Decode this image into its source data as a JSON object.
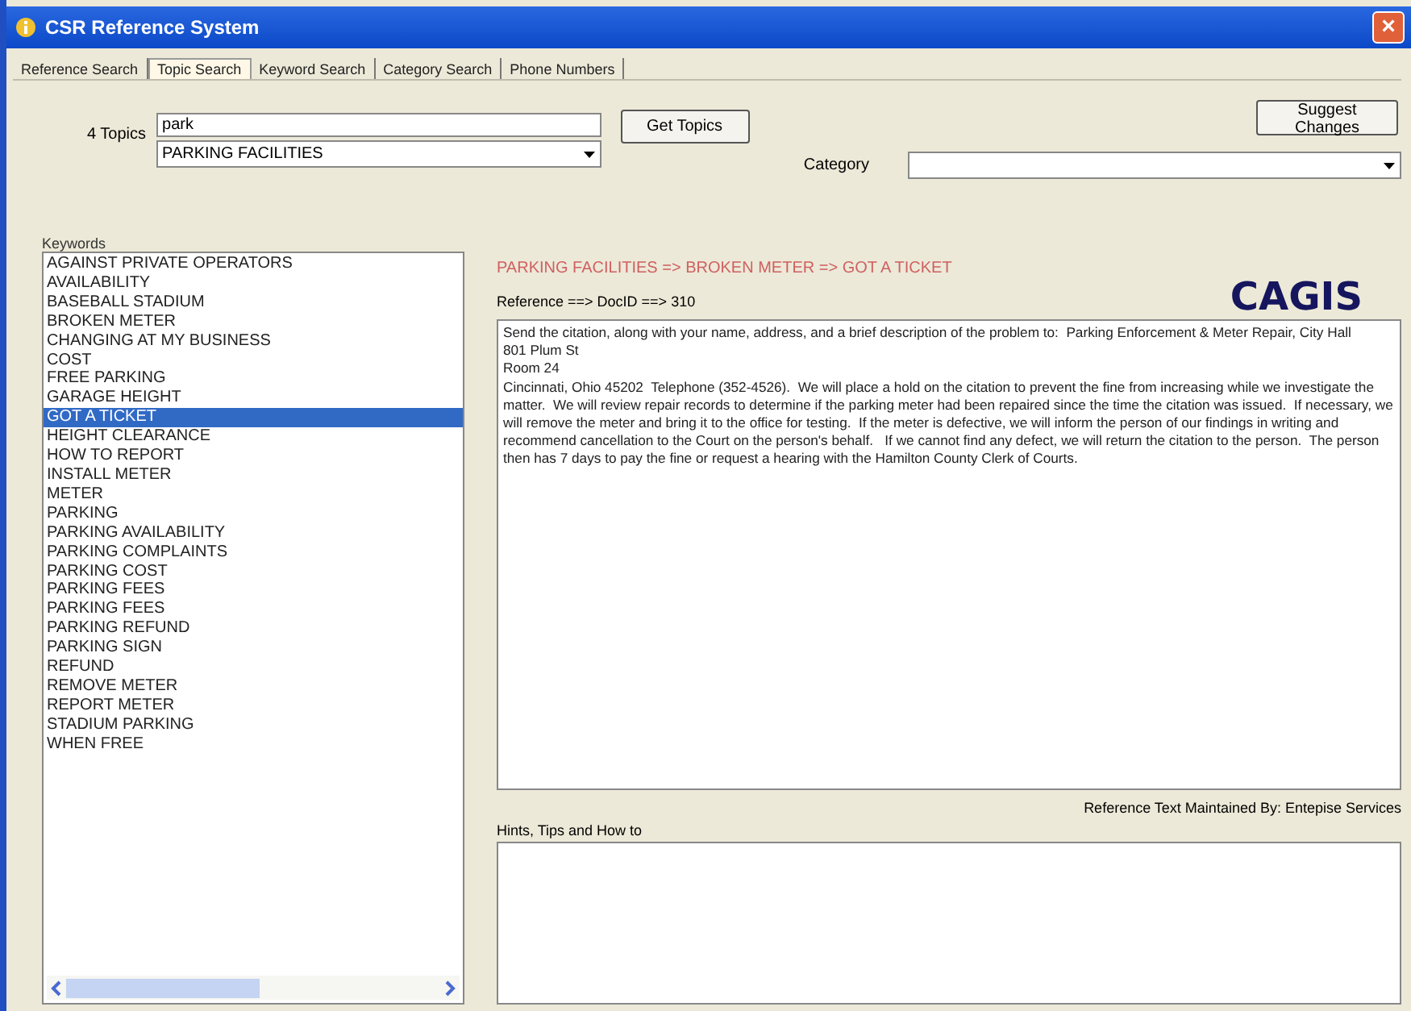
{
  "window": {
    "title": "CSR Reference System",
    "close": "×"
  },
  "tabs": [
    {
      "label": "Reference Search",
      "selected": false
    },
    {
      "label": "Topic Search",
      "selected": true
    },
    {
      "label": "Keyword Search",
      "selected": false
    },
    {
      "label": "Category Search",
      "selected": false
    },
    {
      "label": "Phone Numbers",
      "selected": false
    }
  ],
  "search": {
    "count_label": "4 Topics",
    "value": "park",
    "topic": "PARKING FACILITIES",
    "button": "Get Topics"
  },
  "suggest_button": "Suggest Changes",
  "category": {
    "label": "Category"
  },
  "keywords": {
    "label": "Keywords",
    "items": [
      {
        "label": "AGAINST PRIVATE OPERATORS",
        "selected": false
      },
      {
        "label": "AVAILABILITY",
        "selected": false
      },
      {
        "label": "BASEBALL STADIUM",
        "selected": false
      },
      {
        "label": "BROKEN METER",
        "selected": false
      },
      {
        "label": "CHANGING AT MY BUSINESS",
        "selected": false
      },
      {
        "label": "COST",
        "selected": false
      },
      {
        "label": "FREE PARKING",
        "selected": false
      },
      {
        "label": "GARAGE HEIGHT",
        "selected": false
      },
      {
        "label": "GOT A TICKET",
        "selected": true
      },
      {
        "label": "HEIGHT CLEARANCE",
        "selected": false
      },
      {
        "label": "HOW TO REPORT",
        "selected": false
      },
      {
        "label": "INSTALL METER",
        "selected": false
      },
      {
        "label": "METER",
        "selected": false
      },
      {
        "label": "PARKING",
        "selected": false
      },
      {
        "label": "PARKING AVAILABILITY",
        "selected": false
      },
      {
        "label": "PARKING COMPLAINTS",
        "selected": false
      },
      {
        "label": "PARKING COST",
        "selected": false
      },
      {
        "label": "PARKING FEES",
        "selected": false
      },
      {
        "label": "PARKING FEES",
        "selected": false
      },
      {
        "label": "PARKING REFUND",
        "selected": false
      },
      {
        "label": "PARKING SIGN",
        "selected": false
      },
      {
        "label": "REFUND",
        "selected": false
      },
      {
        "label": "REMOVE METER",
        "selected": false
      },
      {
        "label": "REPORT METER",
        "selected": false
      },
      {
        "label": "STADIUM PARKING",
        "selected": false
      },
      {
        "label": "WHEN FREE",
        "selected": false
      }
    ]
  },
  "detail": {
    "breadcrumb": "PARKING FACILITIES => BROKEN METER => GOT A TICKET",
    "reference": "Reference ==> DocID ==>  310",
    "logo": "CAGIS",
    "text": "Send the citation, along with your name, address, and a brief description of the problem to:  Parking Enforcement & Meter Repair, City Hall\n801 Plum St\nRoom 24\nCincinnati, Ohio 45202  Telephone (352-4526).  We will place a hold on the citation to prevent the fine from increasing while we investigate the matter.  We will review repair records to determine if the parking meter had been repaired since the time the citation was issued.  If necessary, we will remove the meter and bring it to the office for testing.  If the meter is defective, we will inform the person of our findings in writing and recommend cancellation to the Court on the person's behalf.   If we cannot find any defect, we will return the citation to the person.  The person then has 7 days to pay the fine or request a hearing with the Hamilton County Clerk of Courts.",
    "hints_label": "Hints, Tips and How to",
    "maintained": "Reference Text Maintained By: Entepise Services"
  }
}
